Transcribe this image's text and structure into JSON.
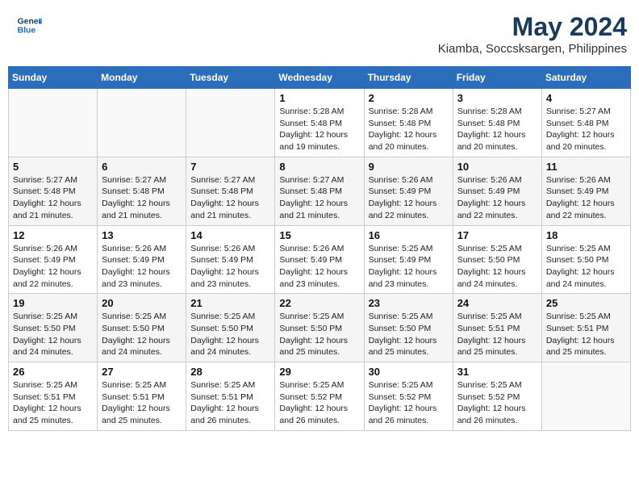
{
  "header": {
    "logo_line1": "General",
    "logo_line2": "Blue",
    "title": "May 2024",
    "subtitle": "Kiamba, Soccsksargen, Philippines"
  },
  "weekdays": [
    "Sunday",
    "Monday",
    "Tuesday",
    "Wednesday",
    "Thursday",
    "Friday",
    "Saturday"
  ],
  "weeks": [
    [
      {
        "day": "",
        "info": ""
      },
      {
        "day": "",
        "info": ""
      },
      {
        "day": "",
        "info": ""
      },
      {
        "day": "1",
        "info": "Sunrise: 5:28 AM\nSunset: 5:48 PM\nDaylight: 12 hours and 19 minutes."
      },
      {
        "day": "2",
        "info": "Sunrise: 5:28 AM\nSunset: 5:48 PM\nDaylight: 12 hours and 20 minutes."
      },
      {
        "day": "3",
        "info": "Sunrise: 5:28 AM\nSunset: 5:48 PM\nDaylight: 12 hours and 20 minutes."
      },
      {
        "day": "4",
        "info": "Sunrise: 5:27 AM\nSunset: 5:48 PM\nDaylight: 12 hours and 20 minutes."
      }
    ],
    [
      {
        "day": "5",
        "info": "Sunrise: 5:27 AM\nSunset: 5:48 PM\nDaylight: 12 hours and 21 minutes."
      },
      {
        "day": "6",
        "info": "Sunrise: 5:27 AM\nSunset: 5:48 PM\nDaylight: 12 hours and 21 minutes."
      },
      {
        "day": "7",
        "info": "Sunrise: 5:27 AM\nSunset: 5:48 PM\nDaylight: 12 hours and 21 minutes."
      },
      {
        "day": "8",
        "info": "Sunrise: 5:27 AM\nSunset: 5:48 PM\nDaylight: 12 hours and 21 minutes."
      },
      {
        "day": "9",
        "info": "Sunrise: 5:26 AM\nSunset: 5:49 PM\nDaylight: 12 hours and 22 minutes."
      },
      {
        "day": "10",
        "info": "Sunrise: 5:26 AM\nSunset: 5:49 PM\nDaylight: 12 hours and 22 minutes."
      },
      {
        "day": "11",
        "info": "Sunrise: 5:26 AM\nSunset: 5:49 PM\nDaylight: 12 hours and 22 minutes."
      }
    ],
    [
      {
        "day": "12",
        "info": "Sunrise: 5:26 AM\nSunset: 5:49 PM\nDaylight: 12 hours and 22 minutes."
      },
      {
        "day": "13",
        "info": "Sunrise: 5:26 AM\nSunset: 5:49 PM\nDaylight: 12 hours and 23 minutes."
      },
      {
        "day": "14",
        "info": "Sunrise: 5:26 AM\nSunset: 5:49 PM\nDaylight: 12 hours and 23 minutes."
      },
      {
        "day": "15",
        "info": "Sunrise: 5:26 AM\nSunset: 5:49 PM\nDaylight: 12 hours and 23 minutes."
      },
      {
        "day": "16",
        "info": "Sunrise: 5:25 AM\nSunset: 5:49 PM\nDaylight: 12 hours and 23 minutes."
      },
      {
        "day": "17",
        "info": "Sunrise: 5:25 AM\nSunset: 5:50 PM\nDaylight: 12 hours and 24 minutes."
      },
      {
        "day": "18",
        "info": "Sunrise: 5:25 AM\nSunset: 5:50 PM\nDaylight: 12 hours and 24 minutes."
      }
    ],
    [
      {
        "day": "19",
        "info": "Sunrise: 5:25 AM\nSunset: 5:50 PM\nDaylight: 12 hours and 24 minutes."
      },
      {
        "day": "20",
        "info": "Sunrise: 5:25 AM\nSunset: 5:50 PM\nDaylight: 12 hours and 24 minutes."
      },
      {
        "day": "21",
        "info": "Sunrise: 5:25 AM\nSunset: 5:50 PM\nDaylight: 12 hours and 24 minutes."
      },
      {
        "day": "22",
        "info": "Sunrise: 5:25 AM\nSunset: 5:50 PM\nDaylight: 12 hours and 25 minutes."
      },
      {
        "day": "23",
        "info": "Sunrise: 5:25 AM\nSunset: 5:50 PM\nDaylight: 12 hours and 25 minutes."
      },
      {
        "day": "24",
        "info": "Sunrise: 5:25 AM\nSunset: 5:51 PM\nDaylight: 12 hours and 25 minutes."
      },
      {
        "day": "25",
        "info": "Sunrise: 5:25 AM\nSunset: 5:51 PM\nDaylight: 12 hours and 25 minutes."
      }
    ],
    [
      {
        "day": "26",
        "info": "Sunrise: 5:25 AM\nSunset: 5:51 PM\nDaylight: 12 hours and 25 minutes."
      },
      {
        "day": "27",
        "info": "Sunrise: 5:25 AM\nSunset: 5:51 PM\nDaylight: 12 hours and 25 minutes."
      },
      {
        "day": "28",
        "info": "Sunrise: 5:25 AM\nSunset: 5:51 PM\nDaylight: 12 hours and 26 minutes."
      },
      {
        "day": "29",
        "info": "Sunrise: 5:25 AM\nSunset: 5:52 PM\nDaylight: 12 hours and 26 minutes."
      },
      {
        "day": "30",
        "info": "Sunrise: 5:25 AM\nSunset: 5:52 PM\nDaylight: 12 hours and 26 minutes."
      },
      {
        "day": "31",
        "info": "Sunrise: 5:25 AM\nSunset: 5:52 PM\nDaylight: 12 hours and 26 minutes."
      },
      {
        "day": "",
        "info": ""
      }
    ]
  ]
}
